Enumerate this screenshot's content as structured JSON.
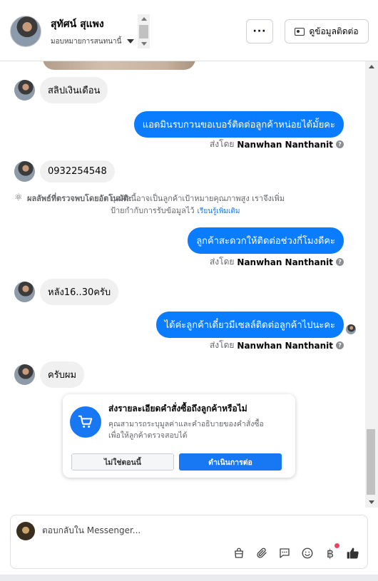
{
  "header": {
    "contact_name": "สุทัศน์ สุแพง",
    "assign_label": "มอบหมายการสนทนานี้",
    "more_label": "···",
    "contact_info_label": "ดูข้อมูลติดต่อ"
  },
  "messages": [
    {
      "direction": "in",
      "text": "สลิปเงินเดือน"
    },
    {
      "direction": "out",
      "text": "แอดมินรบกวนขอเบอร์ติดต่อลูกค้าหน่อยได้มั้ยคะ",
      "sent_by_prefix": "ส่งโดย",
      "sender": "Nanwhan Nanthanit"
    },
    {
      "direction": "in",
      "text": "0932254548"
    },
    {
      "direction": "out",
      "text": "ลูกค้าสะดวกให้ติดต่อช่วงกี่โมงดีคะ",
      "sent_by_prefix": "ส่งโดย",
      "sender": "Nanwhan Nanthanit"
    },
    {
      "direction": "in",
      "text": "หลัง16..30ครับ"
    },
    {
      "direction": "out",
      "text": "ได้ค่ะลูกค้าเดี๋ยวมีเซลล์ติดต่อลูกค้าไปนะคะ",
      "sent_by_prefix": "ส่งโดย",
      "sender": "Nanwhan Nanthanit"
    },
    {
      "direction": "in",
      "text": "ครับผม"
    }
  ],
  "auto_detect": {
    "label": "ผลลัพธ์ที่ตรวจพบโดยอัตโนมัติ:",
    "text_line1": "บุคคลนี้อาจเป็นลูกค้าเป้าหมายคุณภาพสูง เราจึงเพิ่ม",
    "text_line2": "ป้ายกำกับการรับข้อมูลไว้",
    "learn_more": "เรียนรู้เพิ่มเติม"
  },
  "order_card": {
    "title": "ส่งรายละเอียดคำสั่งซื้อถึงลูกค้าหรือไม่",
    "desc_line1": "คุณสามารถระบุมูลค่าและคำอธิบายของคำสั่งซื้อ",
    "desc_line2": "เพื่อให้ลูกค้าตรวจสอบได้",
    "no_label": "ไม่ใช่ตอนนี้",
    "continue_label": "ดำเนินการต่อ"
  },
  "composer": {
    "placeholder": "ตอบกลับใน Messenger..."
  },
  "colors": {
    "outgoing_bubble": "#0a7cff",
    "incoming_bubble": "#f0f0f0",
    "primary_button": "#1877f2"
  }
}
